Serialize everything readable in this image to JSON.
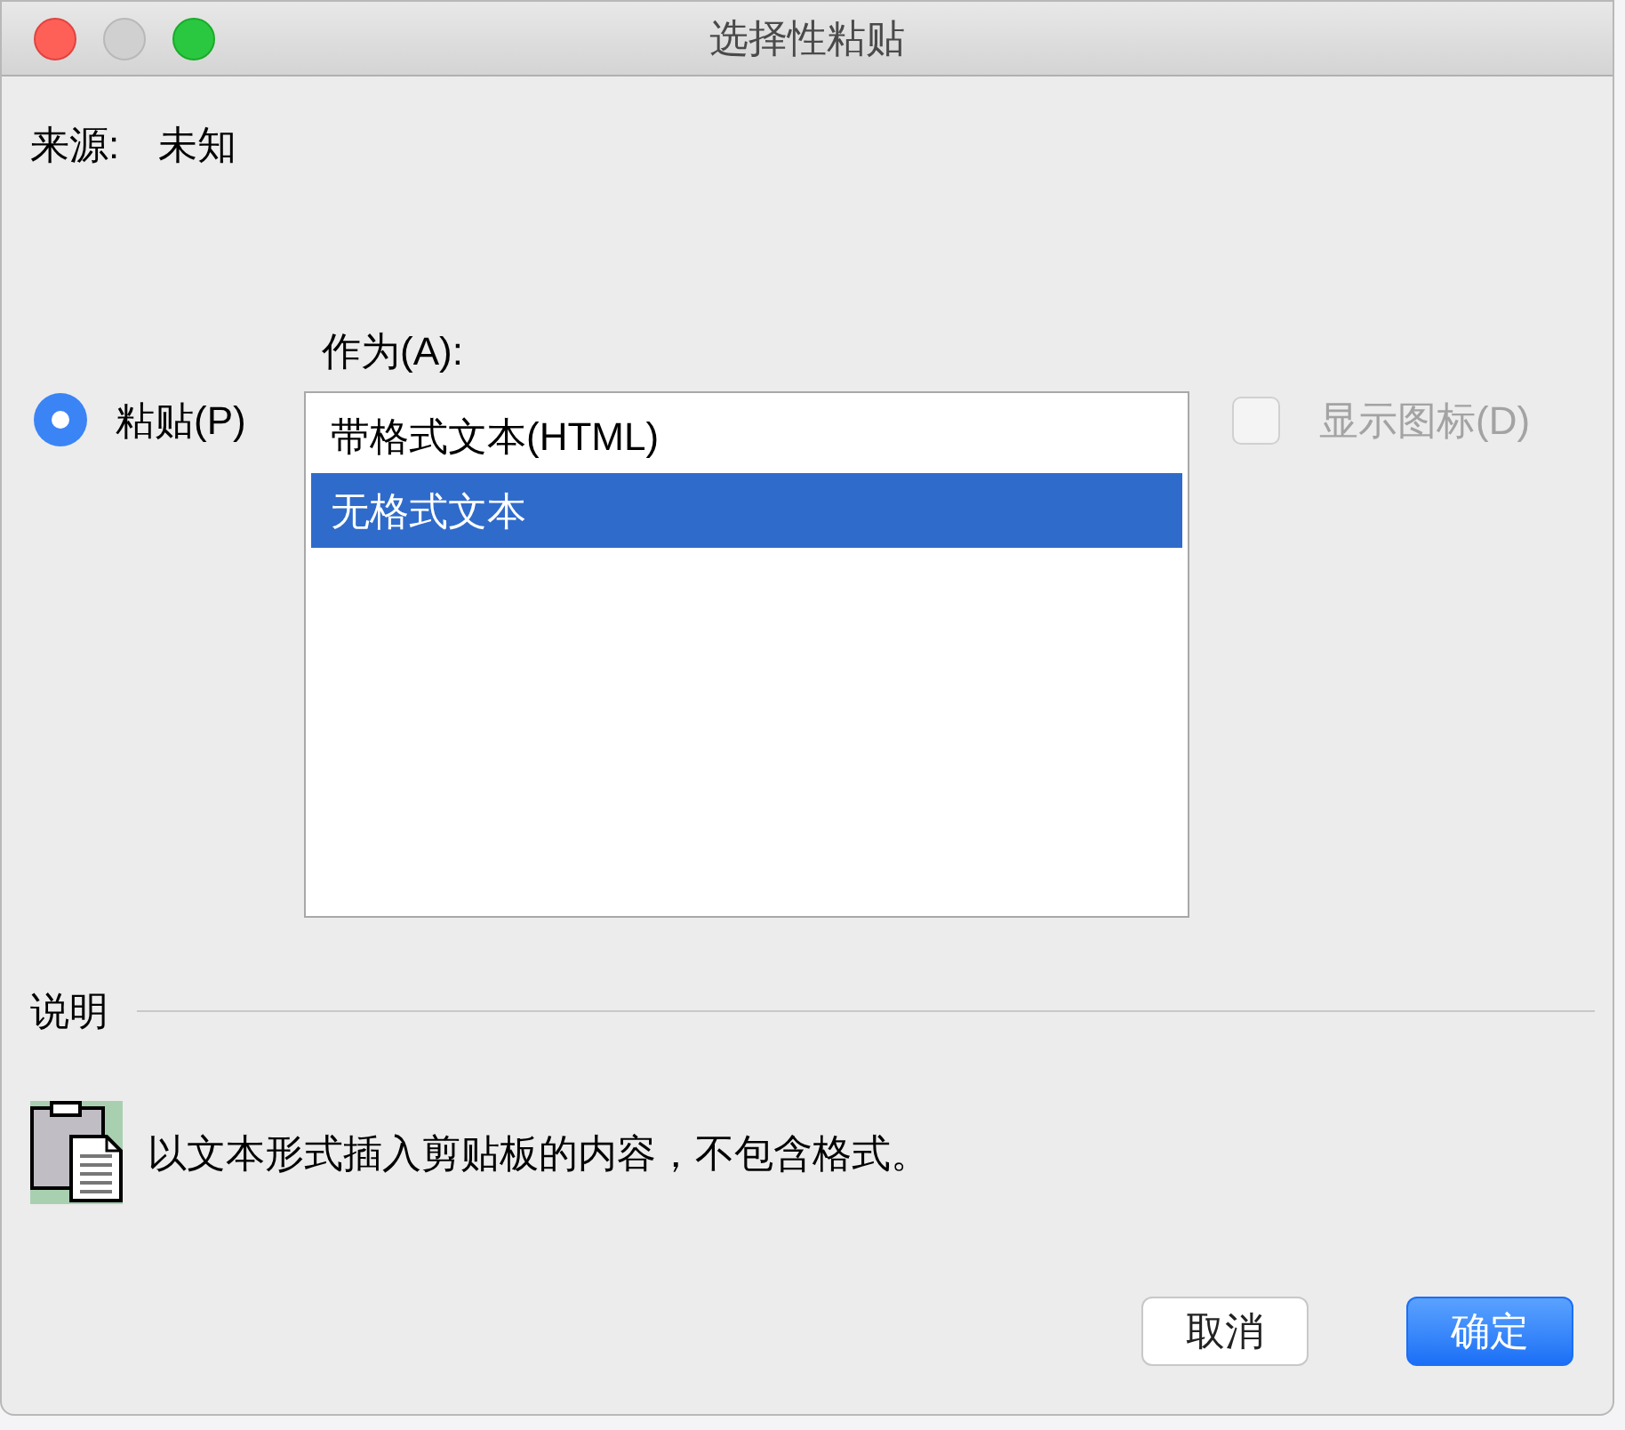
{
  "window": {
    "title": "选择性粘贴"
  },
  "source": {
    "label": "来源:",
    "value": "未知"
  },
  "paste_option": {
    "label": "粘贴(P)",
    "selected": true
  },
  "as_list": {
    "label": "作为(A):",
    "items": [
      {
        "label": "带格式文本(HTML)",
        "selected": false
      },
      {
        "label": "无格式文本",
        "selected": true
      }
    ]
  },
  "show_icon": {
    "label": "显示图标(D)",
    "checked": false,
    "disabled": true
  },
  "description": {
    "heading": "说明",
    "text": "以文本形式插入剪贴板的内容，不包含格式。"
  },
  "buttons": [
    {
      "label": "取消",
      "kind": "secondary"
    },
    {
      "label": "确定",
      "kind": "primary"
    }
  ]
}
